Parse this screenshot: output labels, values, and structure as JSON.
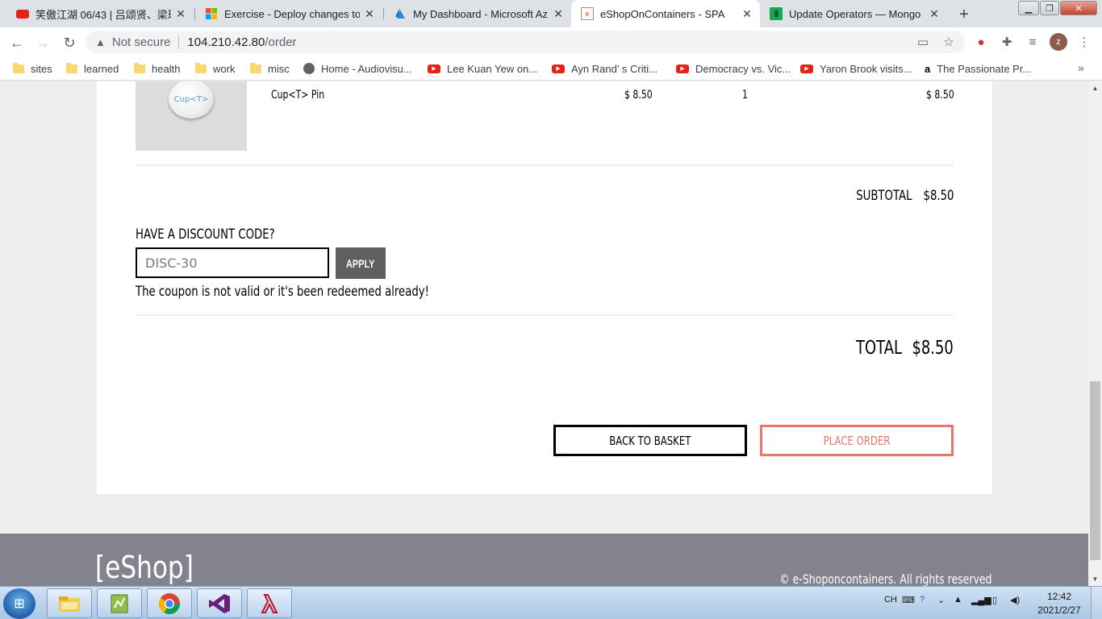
{
  "browser": {
    "tabs": [
      {
        "title": "笑傲江湖 06/43 | 吕颂贤、梁琤",
        "icon": "youtube-icon"
      },
      {
        "title": "Exercise - Deploy changes to",
        "icon": "microsoft-icon"
      },
      {
        "title": "My Dashboard - Microsoft Az",
        "icon": "azure-icon"
      },
      {
        "title": "eShopOnContainers - SPA",
        "icon": "eshop-icon",
        "active": true
      },
      {
        "title": "Update Operators — Mongo",
        "icon": "mongodb-icon"
      }
    ],
    "address": {
      "security_label": "Not secure",
      "host": "104.210.42.80",
      "path": "/order"
    },
    "bookmarks": [
      {
        "label": "sites",
        "icon": "folder-icon"
      },
      {
        "label": "learned",
        "icon": "folder-icon"
      },
      {
        "label": "health",
        "icon": "folder-icon"
      },
      {
        "label": "work",
        "icon": "folder-icon"
      },
      {
        "label": "misc",
        "icon": "folder-icon"
      },
      {
        "label": "Home - Audiovisu...",
        "icon": "globe-icon"
      },
      {
        "label": "Lee Kuan Yew on...",
        "icon": "youtube-icon"
      },
      {
        "label": "Ayn Rand’ s Criti...",
        "icon": "youtube-icon"
      },
      {
        "label": "Democracy vs. Vic...",
        "icon": "youtube-icon"
      },
      {
        "label": "Yaron Brook visits...",
        "icon": "youtube-icon"
      },
      {
        "label": "The Passionate Pr...",
        "icon": "amazon-icon"
      }
    ],
    "profile_initial": "z"
  },
  "order": {
    "item": {
      "image_text": "Cup<T>",
      "name": "Cup<T> Pin",
      "price": "$ 8.50",
      "quantity": "1",
      "line_total": "$ 8.50"
    },
    "subtotal_label": "SUBTOTAL",
    "subtotal_value": "$8.50",
    "discount": {
      "title": "HAVE A DISCOUNT CODE?",
      "placeholder": "DISC-30",
      "value": "",
      "apply_label": "APPLY",
      "message": "The coupon is not valid or it's been redeemed already!"
    },
    "total_label": "TOTAL",
    "total_value": "$8.50",
    "back_label": "BACK TO BASKET",
    "place_label": "PLACE ORDER"
  },
  "footer": {
    "brand": "[eShop]",
    "copyright": "© e-Shoponcontainers. All rights reserved"
  },
  "taskbar": {
    "apps": [
      "file-explorer-icon",
      "notes-icon",
      "chrome-icon",
      "visual-studio-icon",
      "lambda-app-icon"
    ],
    "tray_lang": "CH",
    "time": "12:42",
    "date": "2021/2/27"
  },
  "colors": {
    "accent": "#e5786a",
    "footer_bg": "#83838f",
    "apply_bg": "#5f5f5f",
    "page_bg": "#eeeeee"
  }
}
